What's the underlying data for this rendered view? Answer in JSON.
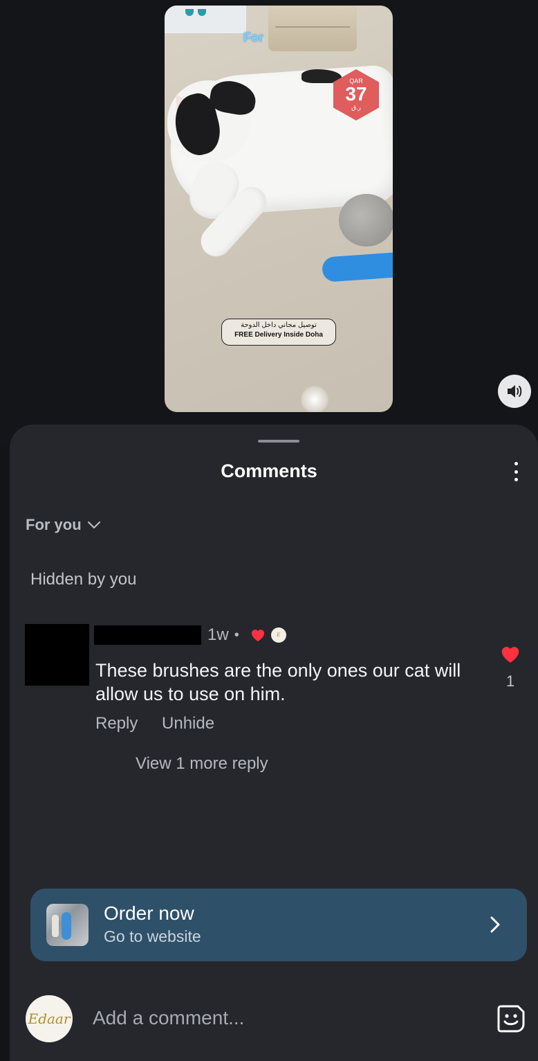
{
  "video": {
    "label_top": "For",
    "price": {
      "currency": "QAR",
      "amount": "37",
      "currency_ar": "ر.ق"
    },
    "delivery": {
      "arabic": "توصيل مجاني داخل الدوحة",
      "english": "FREE Delivery Inside Doha"
    }
  },
  "sheet": {
    "title": "Comments",
    "filter_label": "For you",
    "hidden_label": "Hidden by you"
  },
  "comment": {
    "time": "1w",
    "text": "These brushes are the only ones our cat will allow us to use on him.",
    "reply_label": "Reply",
    "unhide_label": "Unhide",
    "like_count": "1",
    "view_more": "View 1 more reply"
  },
  "order": {
    "title": "Order now",
    "subtitle": "Go to website"
  },
  "composer": {
    "placeholder": "Add a comment...",
    "avatar_text": "Edaar"
  },
  "colors": {
    "sheet_bg": "#25272d",
    "order_bg": "#2f5069",
    "like_red": "#ff3040",
    "badge_red": "#df5d5d"
  },
  "icons": [
    "speaker-icon",
    "kebab-menu-icon",
    "chevron-down-icon",
    "heart-icon",
    "chevron-right-icon",
    "sticker-icon"
  ]
}
